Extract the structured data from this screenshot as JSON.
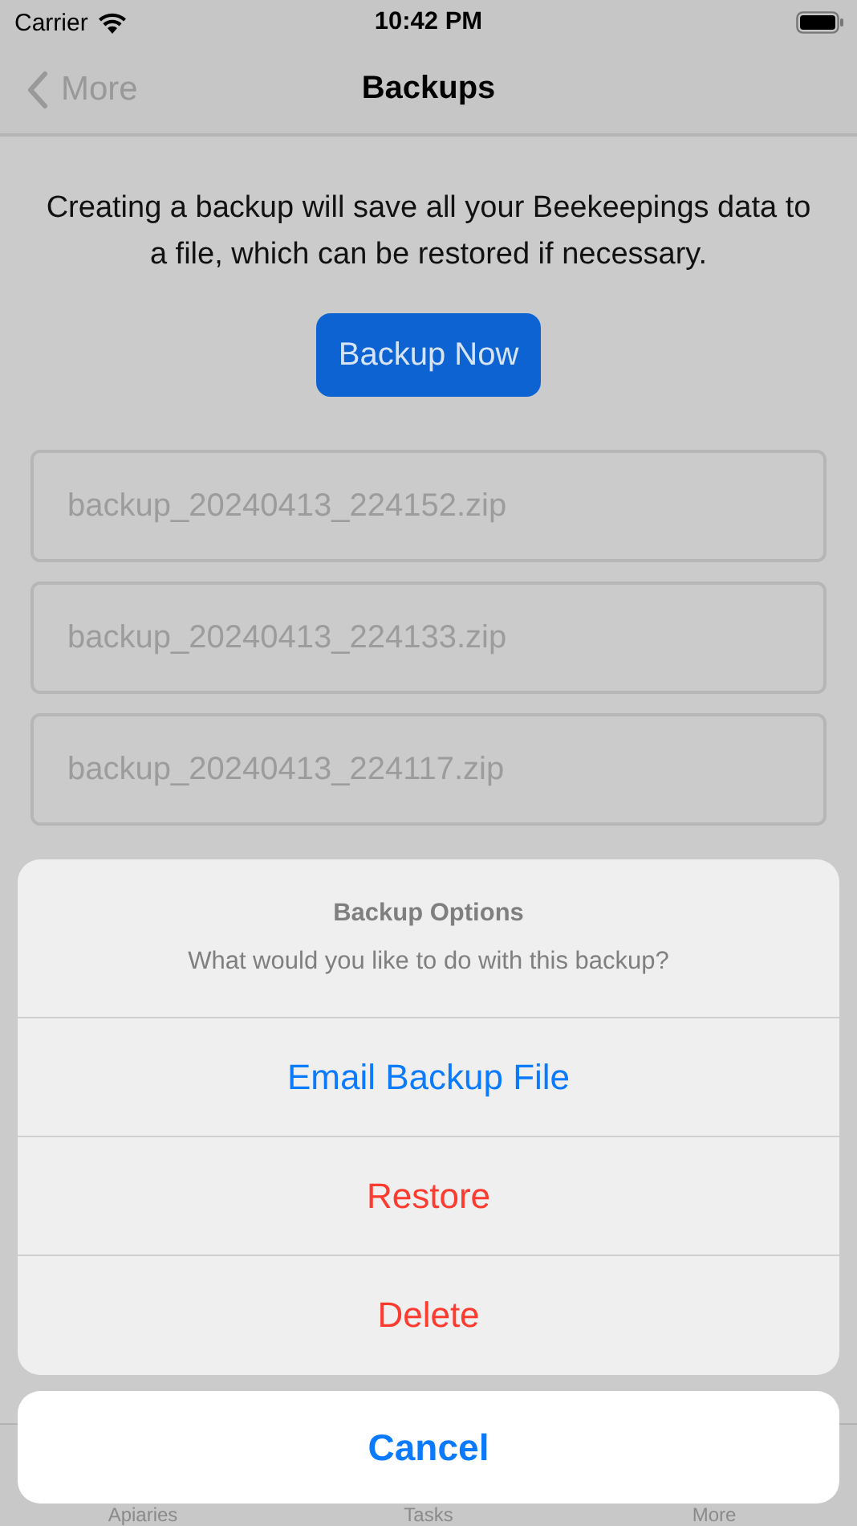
{
  "status_bar": {
    "carrier": "Carrier",
    "time": "10:42 PM"
  },
  "nav": {
    "back": "More",
    "title": "Backups"
  },
  "intro": "Creating a backup will save all your Beekeepings data to a file, which can be restored if necessary.",
  "backup_button": "Backup Now",
  "backups": [
    {
      "name": "backup_20240413_224152.zip"
    },
    {
      "name": "backup_20240413_224133.zip"
    },
    {
      "name": "backup_20240413_224117.zip"
    }
  ],
  "tab_bar": [
    {
      "label": "Apiaries"
    },
    {
      "label": "Tasks"
    },
    {
      "label": "More"
    }
  ],
  "action_sheet": {
    "title": "Backup Options",
    "message": "What would you like to do with this backup?",
    "actions": [
      {
        "label": "Email Backup File",
        "kind": "default"
      },
      {
        "label": "Restore",
        "kind": "destructive"
      },
      {
        "label": "Delete",
        "kind": "destructive"
      }
    ],
    "cancel": "Cancel"
  }
}
